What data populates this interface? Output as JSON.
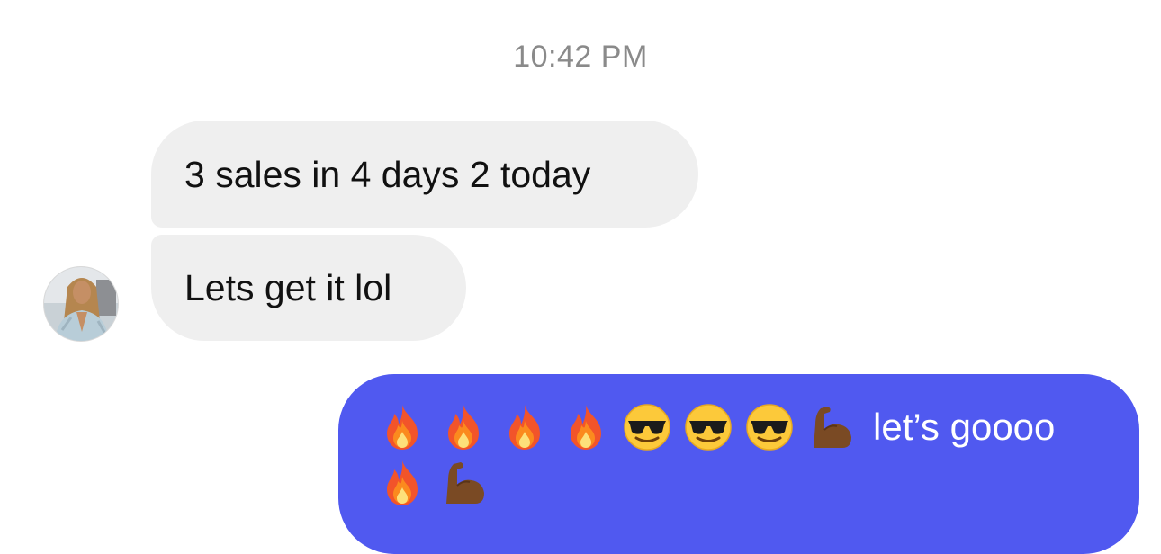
{
  "conversation": {
    "timestamp": "10:42 PM",
    "incoming_messages": [
      {
        "text": "3 sales in 4 days 2 today"
      },
      {
        "text": "Lets get it lol"
      }
    ],
    "outgoing_message": {
      "text": "let’s goooo",
      "emoji_line_1": [
        "fire",
        "fire",
        "fire",
        "fire",
        "sunglasses-face",
        "sunglasses-face",
        "sunglasses-face",
        "flexed-biceps"
      ],
      "emoji_line_2": [
        "fire",
        "flexed-biceps"
      ]
    },
    "avatar": {
      "icon": "profile-photo"
    }
  },
  "colors": {
    "incoming_bubble": "#efefef",
    "outgoing_bubble": "#5059f0",
    "timestamp_text": "#8a8a8a"
  }
}
